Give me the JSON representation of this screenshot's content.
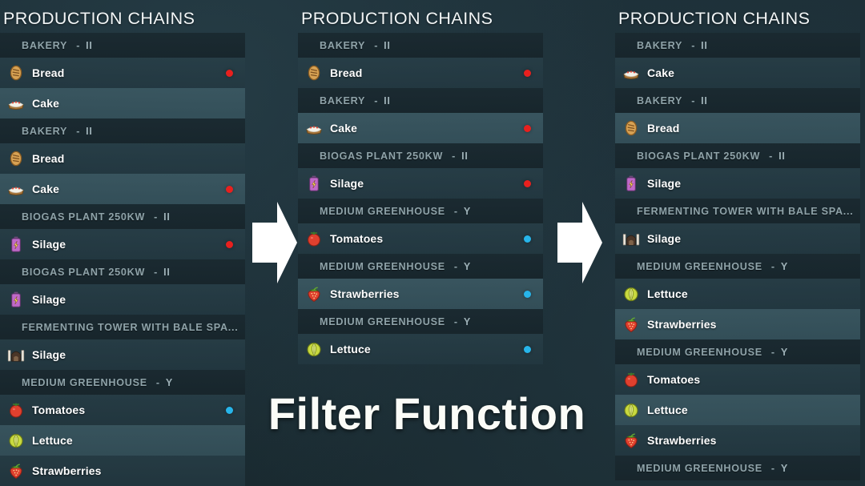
{
  "caption": "Filter Function",
  "colors": {
    "background": "#1b2c34",
    "row_normal": "#283f48",
    "row_alt": "#3e5c66",
    "header_row": "#1a2930",
    "dot_red": "#e8201e",
    "dot_blue": "#27b5ea",
    "title_text": "#f2f6f7",
    "header_text": "#8fa3a9",
    "item_text": "#ffffff"
  },
  "icons": {
    "bread": "bread-icon",
    "cake": "cake-icon",
    "silage": "silage-bottle-icon",
    "silage_tower": "fermenting-tower-icon",
    "tomatoes": "tomato-icon",
    "lettuce": "lettuce-icon",
    "strawberries": "strawberry-icon"
  },
  "panels": [
    {
      "title": "PRODUCTION CHAINS",
      "rows": [
        {
          "kind": "header",
          "name": "BAKERY",
          "sep": "-",
          "slot": "II"
        },
        {
          "kind": "item",
          "label": "Bread",
          "icon": "bread",
          "dot": "red",
          "alt": false
        },
        {
          "kind": "item",
          "label": "Cake",
          "icon": "cake",
          "dot": "none",
          "alt": true
        },
        {
          "kind": "header",
          "name": "BAKERY",
          "sep": "-",
          "slot": "II"
        },
        {
          "kind": "item",
          "label": "Bread",
          "icon": "bread",
          "dot": "none",
          "alt": false
        },
        {
          "kind": "item",
          "label": "Cake",
          "icon": "cake",
          "dot": "red",
          "alt": true
        },
        {
          "kind": "header",
          "name": "BIOGAS PLANT 250KW",
          "sep": "-",
          "slot": "II"
        },
        {
          "kind": "item",
          "label": "Silage",
          "icon": "silage",
          "dot": "red",
          "alt": false
        },
        {
          "kind": "header",
          "name": "BIOGAS PLANT 250KW",
          "sep": "-",
          "slot": "II"
        },
        {
          "kind": "item",
          "label": "Silage",
          "icon": "silage",
          "dot": "none",
          "alt": false
        },
        {
          "kind": "header",
          "name": "FERMENTING TOWER WITH BALE SPA...",
          "sep": "",
          "slot": ""
        },
        {
          "kind": "item",
          "label": "Silage",
          "icon": "silage_tower",
          "dot": "none",
          "alt": false
        },
        {
          "kind": "header",
          "name": "MEDIUM GREENHOUSE",
          "sep": "-",
          "slot": "Y"
        },
        {
          "kind": "item",
          "label": "Tomatoes",
          "icon": "tomatoes",
          "dot": "blue",
          "alt": false
        },
        {
          "kind": "item",
          "label": "Lettuce",
          "icon": "lettuce",
          "dot": "none",
          "alt": true
        },
        {
          "kind": "item",
          "label": "Strawberries",
          "icon": "strawberries",
          "dot": "none",
          "alt": false
        }
      ]
    },
    {
      "title": "PRODUCTION CHAINS",
      "rows": [
        {
          "kind": "header",
          "name": "BAKERY",
          "sep": "-",
          "slot": "II"
        },
        {
          "kind": "item",
          "label": "Bread",
          "icon": "bread",
          "dot": "red",
          "alt": false
        },
        {
          "kind": "header",
          "name": "BAKERY",
          "sep": "-",
          "slot": "II"
        },
        {
          "kind": "item",
          "label": "Cake",
          "icon": "cake",
          "dot": "red",
          "alt": true
        },
        {
          "kind": "header",
          "name": "BIOGAS PLANT 250KW",
          "sep": "-",
          "slot": "II"
        },
        {
          "kind": "item",
          "label": "Silage",
          "icon": "silage",
          "dot": "red",
          "alt": false
        },
        {
          "kind": "header",
          "name": "MEDIUM GREENHOUSE",
          "sep": "-",
          "slot": "Y"
        },
        {
          "kind": "item",
          "label": "Tomatoes",
          "icon": "tomatoes",
          "dot": "blue",
          "alt": false
        },
        {
          "kind": "header",
          "name": "MEDIUM GREENHOUSE",
          "sep": "-",
          "slot": "Y"
        },
        {
          "kind": "item",
          "label": "Strawberries",
          "icon": "strawberries",
          "dot": "blue",
          "alt": true
        },
        {
          "kind": "header",
          "name": "MEDIUM GREENHOUSE",
          "sep": "-",
          "slot": "Y"
        },
        {
          "kind": "item",
          "label": "Lettuce",
          "icon": "lettuce",
          "dot": "blue",
          "alt": false
        }
      ]
    },
    {
      "title": "PRODUCTION CHAINS",
      "rows": [
        {
          "kind": "header",
          "name": "BAKERY",
          "sep": "-",
          "slot": "II"
        },
        {
          "kind": "item",
          "label": "Cake",
          "icon": "cake",
          "dot": "none",
          "alt": false
        },
        {
          "kind": "header",
          "name": "BAKERY",
          "sep": "-",
          "slot": "II"
        },
        {
          "kind": "item",
          "label": "Bread",
          "icon": "bread",
          "dot": "none",
          "alt": true
        },
        {
          "kind": "header",
          "name": "BIOGAS PLANT 250KW",
          "sep": "-",
          "slot": "II"
        },
        {
          "kind": "item",
          "label": "Silage",
          "icon": "silage",
          "dot": "none",
          "alt": false
        },
        {
          "kind": "header",
          "name": "FERMENTING TOWER WITH BALE SPA...",
          "sep": "",
          "slot": ""
        },
        {
          "kind": "item",
          "label": "Silage",
          "icon": "silage_tower",
          "dot": "none",
          "alt": false
        },
        {
          "kind": "header",
          "name": "MEDIUM GREENHOUSE",
          "sep": "-",
          "slot": "Y"
        },
        {
          "kind": "item",
          "label": "Lettuce",
          "icon": "lettuce",
          "dot": "none",
          "alt": false
        },
        {
          "kind": "item",
          "label": "Strawberries",
          "icon": "strawberries",
          "dot": "none",
          "alt": true
        },
        {
          "kind": "header",
          "name": "MEDIUM GREENHOUSE",
          "sep": "-",
          "slot": "Y"
        },
        {
          "kind": "item",
          "label": "Tomatoes",
          "icon": "tomatoes",
          "dot": "none",
          "alt": false
        },
        {
          "kind": "item",
          "label": "Lettuce",
          "icon": "lettuce",
          "dot": "none",
          "alt": true
        },
        {
          "kind": "item",
          "label": "Strawberries",
          "icon": "strawberries",
          "dot": "none",
          "alt": false
        },
        {
          "kind": "header",
          "name": "MEDIUM GREENHOUSE",
          "sep": "-",
          "slot": "Y"
        }
      ]
    }
  ],
  "arrows": [
    {
      "name": "filter-arrow-1",
      "direction": "right"
    },
    {
      "name": "filter-arrow-2",
      "direction": "right"
    }
  ]
}
